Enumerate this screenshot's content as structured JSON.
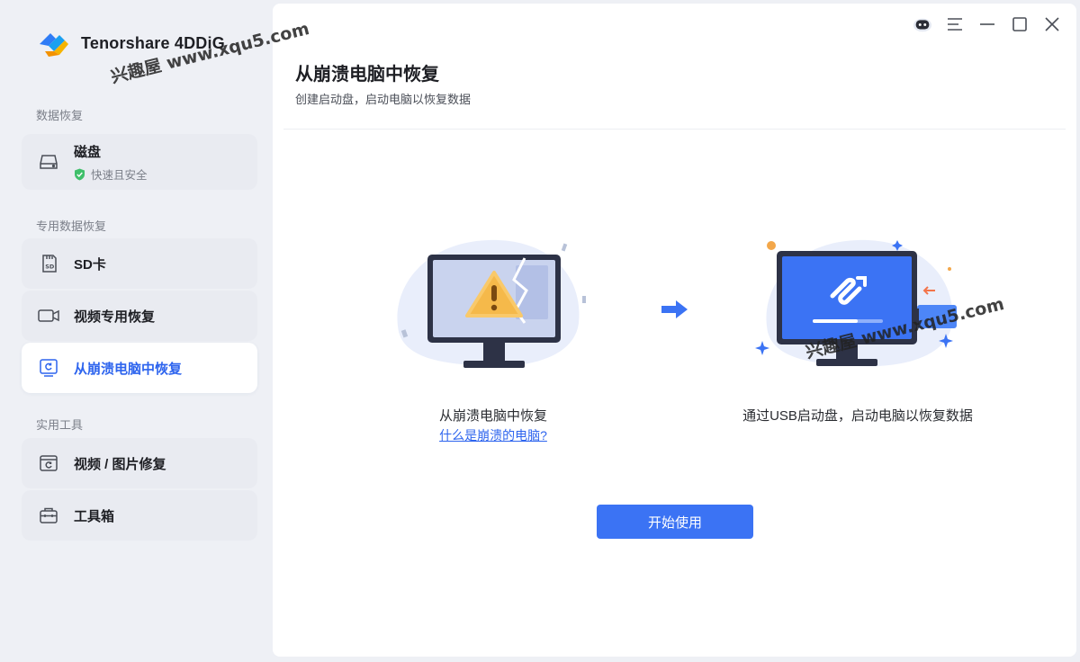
{
  "app": {
    "brand_name": "Tenorshare 4DDiG"
  },
  "sidebar": {
    "section_data_recovery": "数据恢复",
    "disk": {
      "label": "磁盘",
      "sub": "快速且安全"
    },
    "section_special_recovery": "专用数据恢复",
    "sd_card": {
      "label": "SD卡"
    },
    "video_recovery": {
      "label": "视频专用恢复"
    },
    "crash_recovery": {
      "label": "从崩溃电脑中恢复"
    },
    "section_tools": "实用工具",
    "photo_repair": {
      "label": "视频 / 图片修复"
    },
    "toolbox": {
      "label": "工具箱"
    }
  },
  "main": {
    "title": "从崩溃电脑中恢复",
    "subtitle": "创建启动盘，启动电脑以恢复数据",
    "left_caption": "从崩溃电脑中恢复",
    "left_link": "什么是崩溃的电脑?",
    "right_caption": "通过USB启动盘，启动电脑以恢复数据",
    "start_button": "开始使用"
  },
  "watermark": {
    "text1": "兴趣屋 www.xqu5.com",
    "text2": "兴趣屋 www.xqu5.com"
  },
  "colors": {
    "accent": "#3b73f4",
    "active_text": "#2d64ee",
    "sidebar_bg": "#eef0f5",
    "success": "#3fbf6a"
  },
  "icons": {
    "brand": "tenorshare-logo",
    "disk": "hard-disk-icon",
    "shield": "shield-check-icon",
    "sd": "sd-card-icon",
    "video": "video-camera-icon",
    "crash": "monitor-refresh-icon",
    "repair": "photo-repair-icon",
    "toolbox": "toolbox-icon",
    "feedback": "robot-feedback-icon",
    "menu": "menu-icon",
    "minimize": "minimize-icon",
    "maximize": "maximize-icon",
    "close": "close-icon"
  }
}
